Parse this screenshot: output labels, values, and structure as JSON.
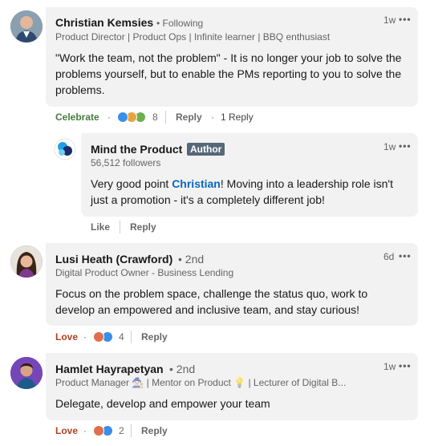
{
  "comments": [
    {
      "author": "Christian Kemsies",
      "relation": "• Following",
      "headline": "Product Director | Product Ops | Infinite learner | BBQ enthusiast",
      "time": "1w",
      "text": "\"Work the team, not the problem\" - It is no longer your job to solve the problems yourself, but to enable the PMs reporting to you to solve the problems.",
      "reaction_label": "Celebrate",
      "reaction_count": "8",
      "reply_label": "Reply",
      "replies_label": "1 Reply",
      "reply": {
        "author": "Mind the Product",
        "badge": "Author",
        "followers": "56,512 followers",
        "time": "1w",
        "text_before": "Very good point ",
        "mention": "Christian",
        "text_after": "! Moving into a leadership role isn't just a promotion - it's a completely different job!",
        "like_label": "Like",
        "reply_label": "Reply"
      }
    },
    {
      "author": "Lusi Heath (Crawford)",
      "relation": "• 2nd",
      "headline": "Digital Product Owner - Business Lending",
      "time": "6d",
      "text": "Focus on the problem space, challenge the status quo, work to develop an empowered and inclusive team, and stay curious!",
      "reaction_label": "Love",
      "reaction_count": "4",
      "reply_label": "Reply"
    },
    {
      "author": "Hamlet Hayrapetyan",
      "relation": "• 2nd",
      "headline": "Product Manager 🧙🏻 | Mentor on Product 💡 | Lecturer of Digital B...",
      "time": "1w",
      "text": "Delegate, develop and empower your team",
      "reaction_label": "Love",
      "reaction_count": "2",
      "reply_label": "Reply"
    }
  ],
  "ui": {
    "more_dots": "•••",
    "dot_separator": "·"
  },
  "colors": {
    "celebrate": "#467a3c",
    "love": "#b24020",
    "mention": "#0a66c2",
    "bubble": "#f2f2f2"
  }
}
